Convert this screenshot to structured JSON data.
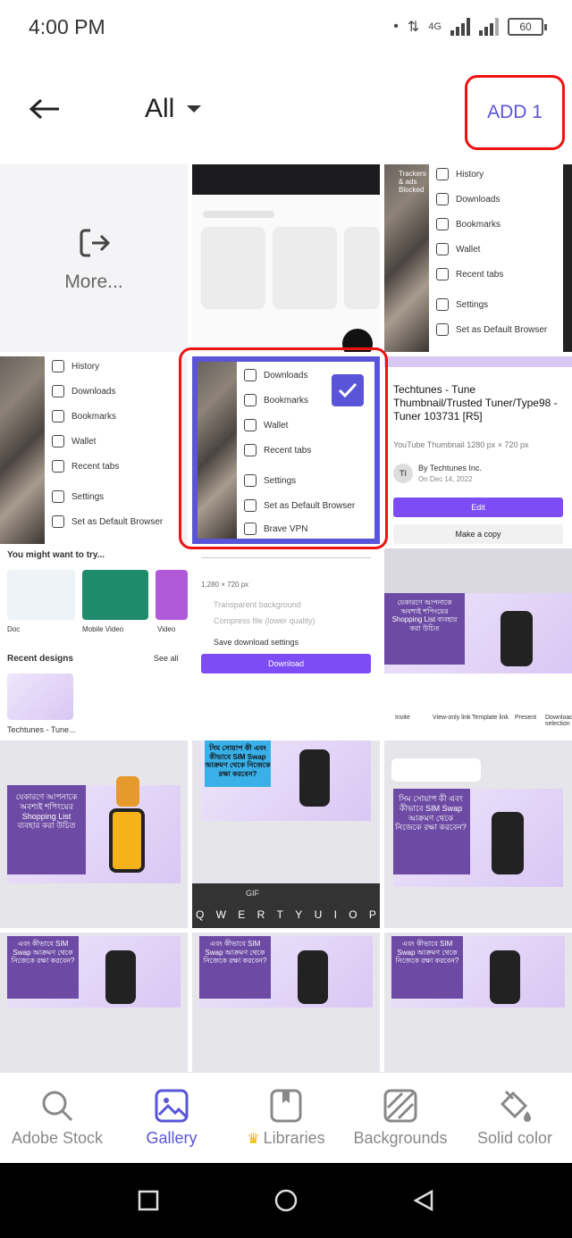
{
  "status_bar": {
    "time": "4:00 PM",
    "network": "4G",
    "battery": "60"
  },
  "header": {
    "filter_label": "All",
    "add_label": "ADD 1"
  },
  "gallery": {
    "more_label": "More...",
    "tile2_menu": [
      "History",
      "Downloads",
      "Bookmarks",
      "Wallet",
      "Recent tabs",
      "Settings",
      "Set as Default Browser"
    ],
    "tile2_top": "Trackers & ads Blocked",
    "tile4_menu": [
      "History",
      "Downloads",
      "Bookmarks",
      "Wallet",
      "Recent tabs",
      "Settings",
      "Set as Default Browser"
    ],
    "selected_menu": [
      "Downloads",
      "Bookmarks",
      "Wallet",
      "Recent tabs",
      "Settings",
      "Set as Default Browser",
      "Brave VPN"
    ],
    "template": {
      "title": "Techtunes - Tune Thumbnail/Trusted Tuner/Type98 - Tuner 103731 [R5]",
      "subtitle": "YouTube Thumbnail 1280 px × 720 px",
      "author": "By Techtunes Inc.",
      "date": "On Dec 14, 2022",
      "edit": "Edit",
      "copy": "Make a copy",
      "avatar": "TI"
    },
    "try_section": {
      "heading": "You might want to try...",
      "items": [
        "Doc",
        "Mobile Video",
        "Video"
      ],
      "recent": "Recent designs",
      "see_all": "See all",
      "recent_item": "Techtunes - Tune..."
    },
    "download_panel": {
      "size": "1,280 × 720 px",
      "option1": "Transparent background",
      "option2": "Compress file (lower quality)",
      "option3": "Save download settings",
      "button": "Download"
    },
    "share_bar": [
      "Invite",
      "View-only link",
      "Template link",
      "Present",
      "Download selection"
    ],
    "keyboard_row": [
      "Q",
      "W",
      "E",
      "R",
      "T",
      "Y",
      "U",
      "I",
      "O",
      "P"
    ],
    "keyboard_top": [
      "GIF"
    ],
    "bangla_card1": "যেকারণে আপনাকে অবশ্যই শপিংয়ের Shopping List ব্যবহার করা উচিত",
    "bangla_card2": "সিম সোয়াপ কী এবং কীভাবে SIM Swap আক্রমণ থেকে নিজেকে রক্ষা করবেন?",
    "bangla_card3": "এবং কীভাবে SIM Swap আক্রমণ থেকে নিজেকে রক্ষা করবেন?"
  },
  "bottom_nav": {
    "items": [
      {
        "label": "Adobe Stock",
        "icon": "search-icon"
      },
      {
        "label": "Gallery",
        "icon": "image-icon"
      },
      {
        "label": "Libraries",
        "icon": "library-icon"
      },
      {
        "label": "Backgrounds",
        "icon": "backgrounds-icon"
      },
      {
        "label": "Solid color",
        "icon": "paint-bucket-icon"
      }
    ]
  },
  "colors": {
    "accent": "#5a55d8",
    "highlight": "#e11111"
  }
}
